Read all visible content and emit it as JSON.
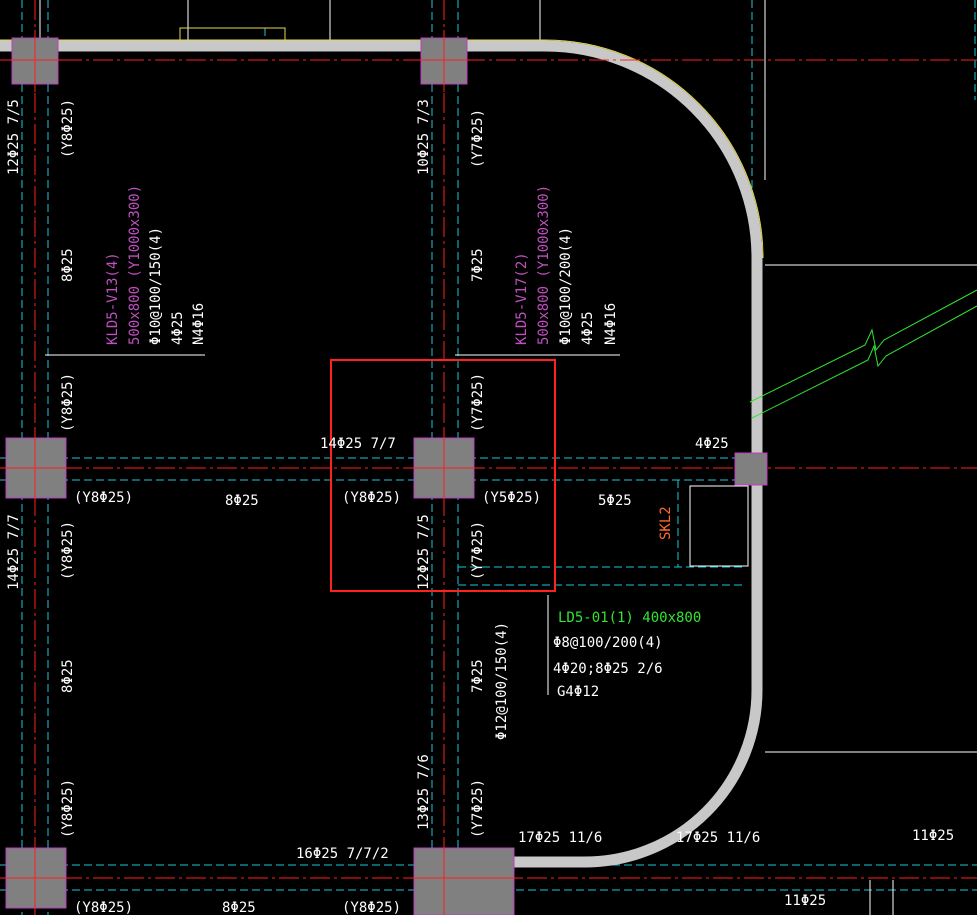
{
  "drawing": {
    "background": "#000000",
    "colors": {
      "beam_edge": "#c8c8c8",
      "beam_fill": "#c8c8c8",
      "column_fill": "#808080",
      "column_edge": "#c03cc0",
      "axis": "#ff2020",
      "hidden": "#18c8d8",
      "selection": "#ff2020",
      "annotation_white": "#ffffff",
      "annotation_magenta": "#c050c0",
      "annotation_green": "#33e333",
      "annotation_orange": "#ff6a2a"
    },
    "labels": {
      "c1_top": "12Φ25 7/5",
      "c1_y": "(Y8Φ25)",
      "c1_mid": "8Φ25",
      "c1_y2": "(Y8Φ25)",
      "c2_top": "10Φ25 7/3",
      "c2_y": "(Y7Φ25)",
      "c2_mid": "7Φ25",
      "c2_y2": "(Y7Φ25)",
      "kl1_name": "KLD5-V13(4)",
      "kl1_size": "500x800 (Y1000x300)",
      "kl1_stirrup": "Φ10@100/150(4)",
      "kl1_top": "4Φ25",
      "kl1_side": "N4Φ16",
      "kl2_name": "KLD5-V17(2)",
      "kl2_size": "500x800 (Y1000x300)",
      "kl2_stirrup": "Φ10@100/200(4)",
      "kl2_top": "4Φ25",
      "kl2_side": "N4Φ16",
      "h_top_c": "14Φ25 7/7",
      "h_right_top": "4Φ25",
      "h_y_left": "(Y8Φ25)",
      "h_mid_left": "8Φ25",
      "h_y_center": "(Y8Φ25)",
      "h_y_right": "(Y5Φ25)",
      "h_mid_right": "5Φ25",
      "skl": "SKL2",
      "l_bot_left": "14Φ25 7/7",
      "l_y_left": "(Y8Φ25)",
      "l_mid_left": "8Φ25",
      "l_y_left2": "(Y8Φ25)",
      "c_bot": "12Φ25 7/5",
      "c_y": "(Y7Φ25)",
      "c_mid": "7Φ25",
      "c_stirrup": "Φ12@100/150(4)",
      "c_bot2": "13Φ25 7/6",
      "c_y2": "(Y7Φ25)",
      "ld_name": "LD5-01(1) 400x800",
      "ld_stirrup": "Φ8@100/200(4)",
      "ld_bars": "4Φ20;8Φ25 2/6",
      "ld_side": "G4Φ12",
      "b_top_c": "16Φ25 7/7/2",
      "b_arc": "17Φ25 11/6",
      "b_right1": "17Φ25 11/6",
      "b_right2": "11Φ25",
      "b_bot_left": "(Y8Φ25)",
      "b_bot_mid": "8Φ25",
      "b_bot_center": "(Y8Φ25)",
      "b_bot_right": "11Φ25"
    }
  }
}
